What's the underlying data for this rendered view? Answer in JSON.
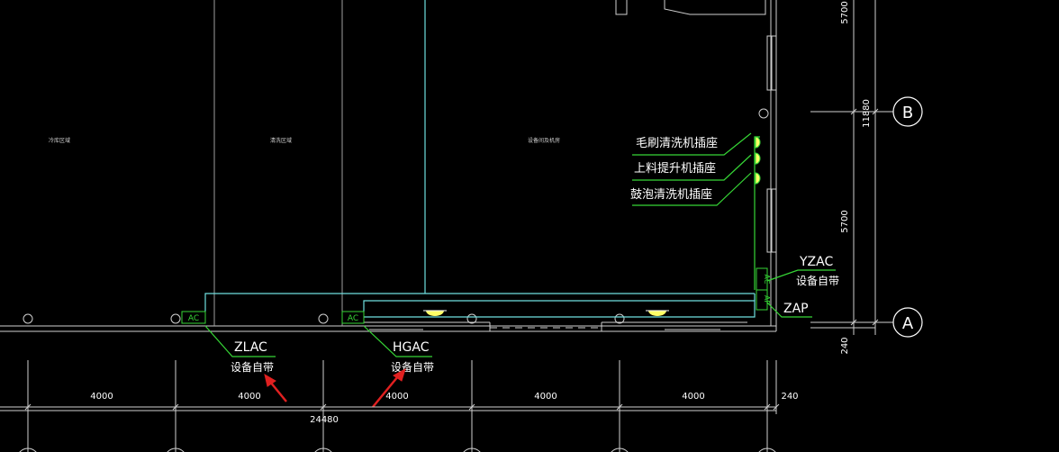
{
  "colors": {
    "background": "#000000",
    "wall": "#cfcfcf",
    "cyan": "#6fe0e0",
    "green": "#36d636",
    "white": "#ffffff",
    "yellow": "#ffff66",
    "red": "#e02020"
  },
  "outlets": [
    {
      "label": "毛刷清洗机插座"
    },
    {
      "label": "上料提升机插座"
    },
    {
      "label": "鼓泡清洗机插座"
    }
  ],
  "boxes": {
    "ac": "AC",
    "ap": "AP"
  },
  "panels": {
    "zlac": {
      "name": "ZLAC",
      "note": "设备自带"
    },
    "hgac": {
      "name": "HGAC",
      "note": "设备自带"
    },
    "yzac": {
      "name": "YZAC",
      "note": "设备自带"
    },
    "zap": {
      "name": "ZAP"
    }
  },
  "axes": {
    "a": "A",
    "b": "B"
  },
  "dimensions": {
    "bays": [
      "4000",
      "4000",
      "4000",
      "4000",
      "4000"
    ],
    "edge_240": "240",
    "total": "24480",
    "right_upper": "5700",
    "right_total": "11880",
    "right_lower": "5700",
    "right_bottom": "240"
  },
  "room_names": [
    {
      "label": "冷库区域"
    },
    {
      "label": "清洗区域"
    },
    {
      "label": "设备间及机房"
    }
  ]
}
